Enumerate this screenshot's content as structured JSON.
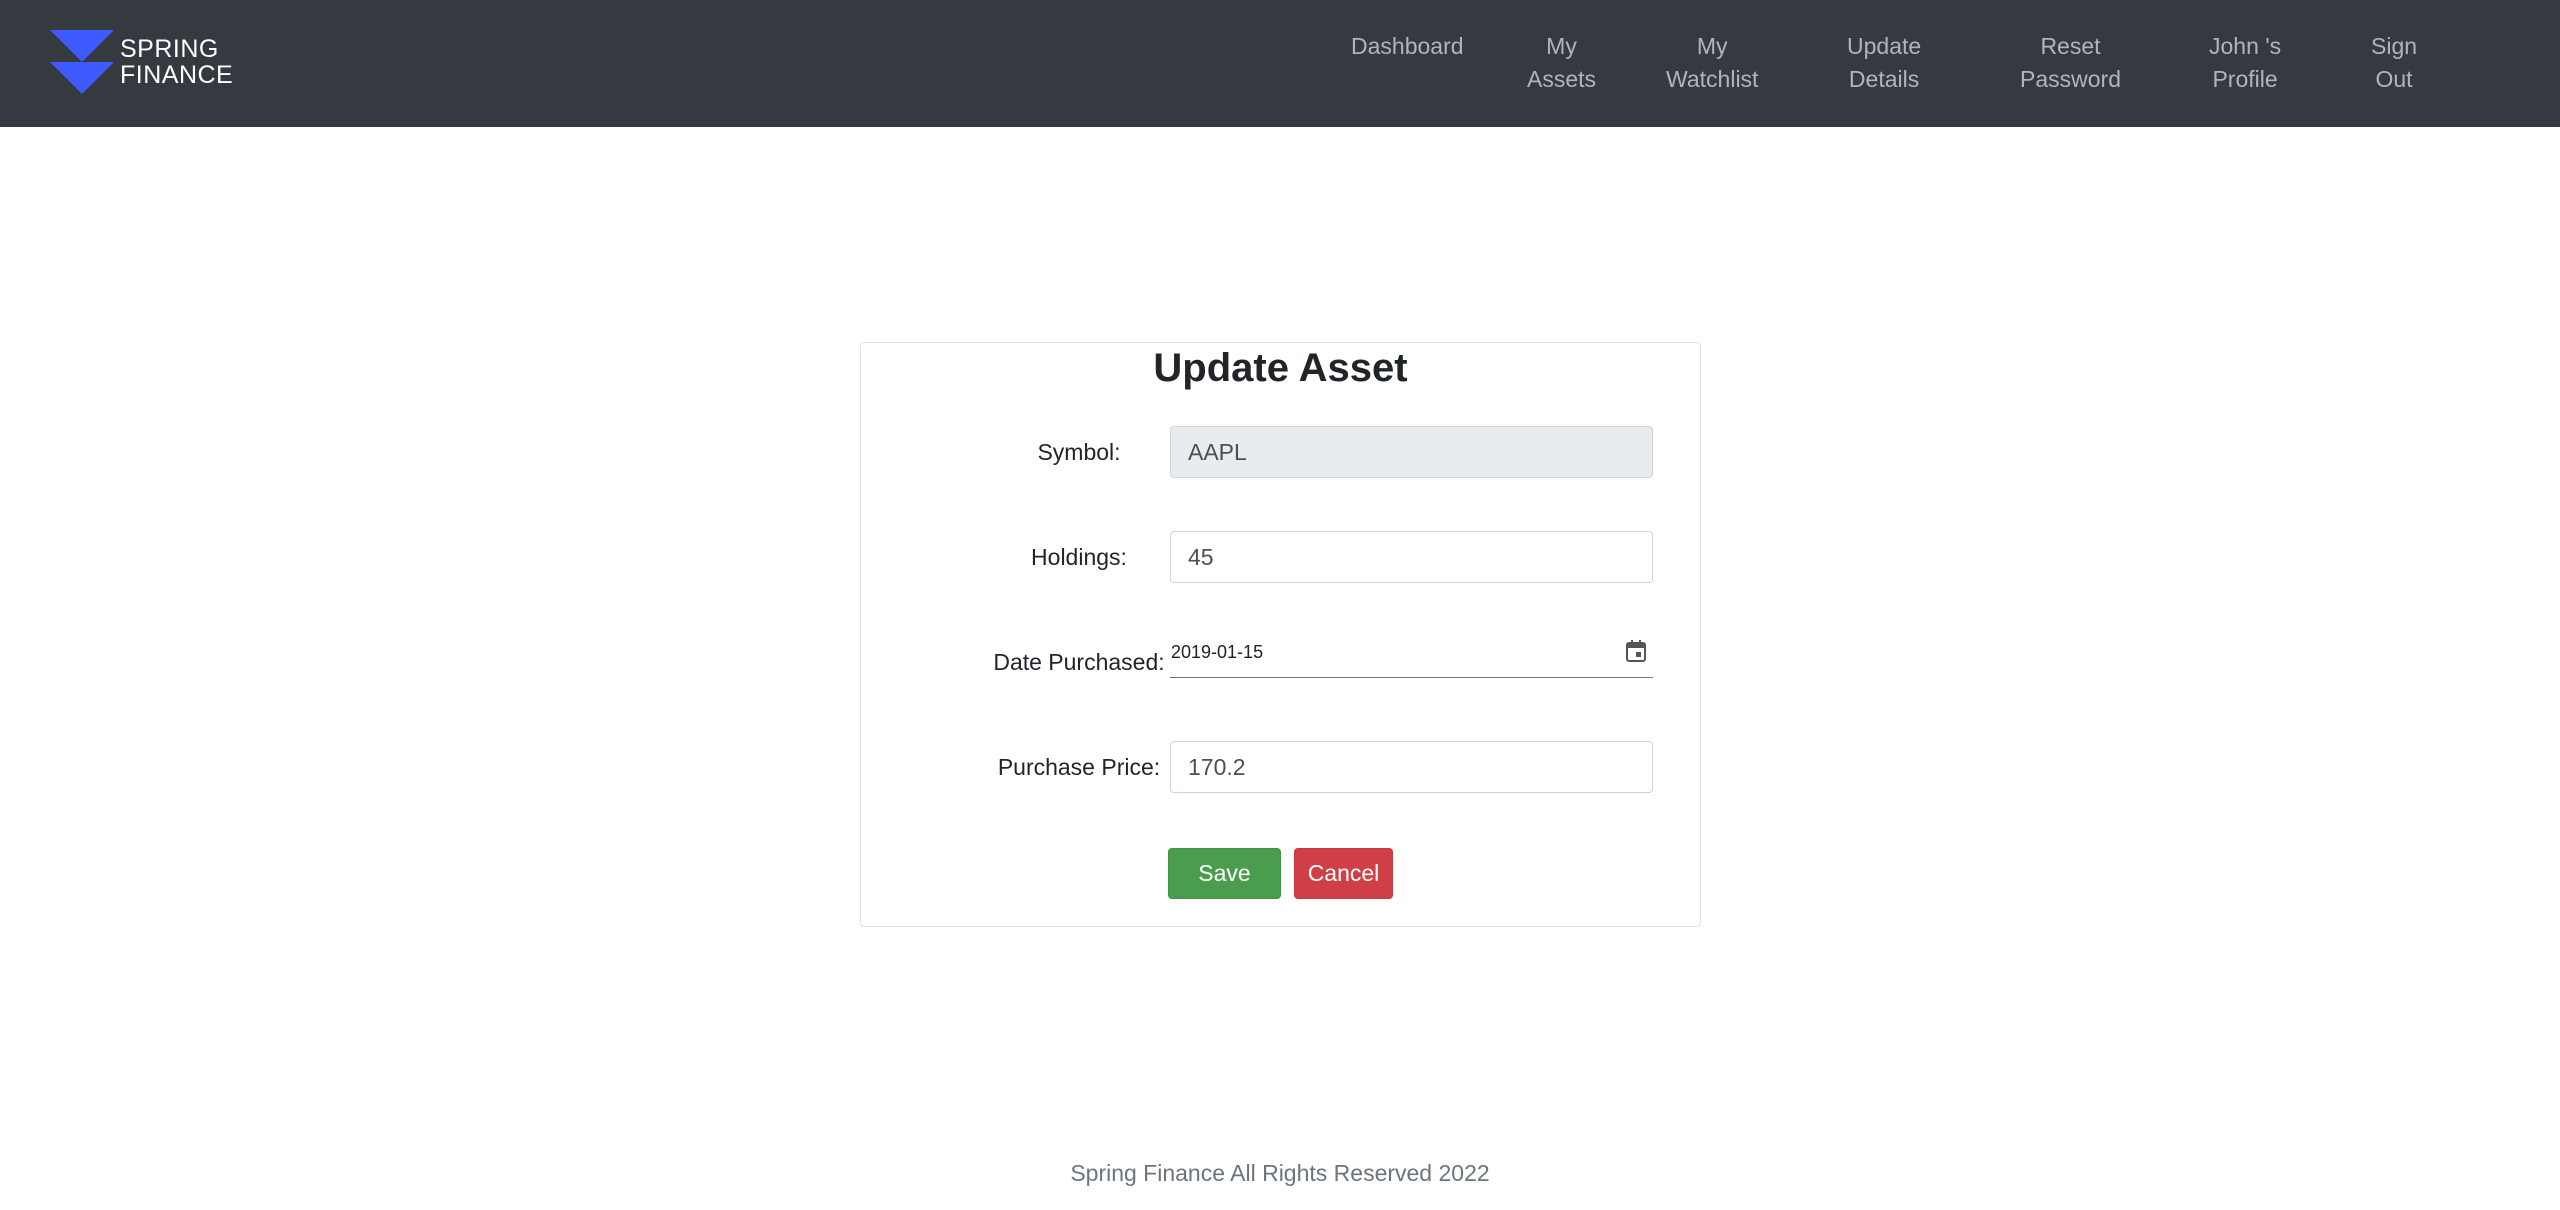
{
  "brand": {
    "line1": "SPRING",
    "line2": "FINANCE",
    "logo_color": "#3d5afe",
    "logo_icon": "spring-finance-logo"
  },
  "nav": {
    "dashboard": {
      "line1": "Dashboard"
    },
    "my_assets": {
      "line1": "My",
      "line2": "Assets"
    },
    "my_watchlist": {
      "line1": "My",
      "line2": "Watchlist"
    },
    "update_details": {
      "line1": "Update",
      "line2": "Details"
    },
    "reset_password": {
      "line1": "Reset",
      "line2": "Password"
    },
    "profile": {
      "line1": "John 's",
      "line2": "Profile"
    },
    "sign_out": {
      "line1": "Sign",
      "line2": "Out"
    }
  },
  "form": {
    "title": "Update Asset",
    "symbol": {
      "label": "Symbol:",
      "value": "AAPL"
    },
    "holdings": {
      "label": "Holdings:",
      "value": "45"
    },
    "date_purchased": {
      "label": "Date Purchased:",
      "value": "2019-01-15",
      "icon": "calendar-icon"
    },
    "purchase_price": {
      "label": "Purchase Price:",
      "value": "170.2"
    },
    "save_label": "Save",
    "cancel_label": "Cancel"
  },
  "colors": {
    "navbar": "#343a40",
    "save": "#4a9d4f",
    "cancel": "#cf3f45"
  },
  "footer": {
    "text": "Spring Finance All Rights Reserved 2022"
  }
}
